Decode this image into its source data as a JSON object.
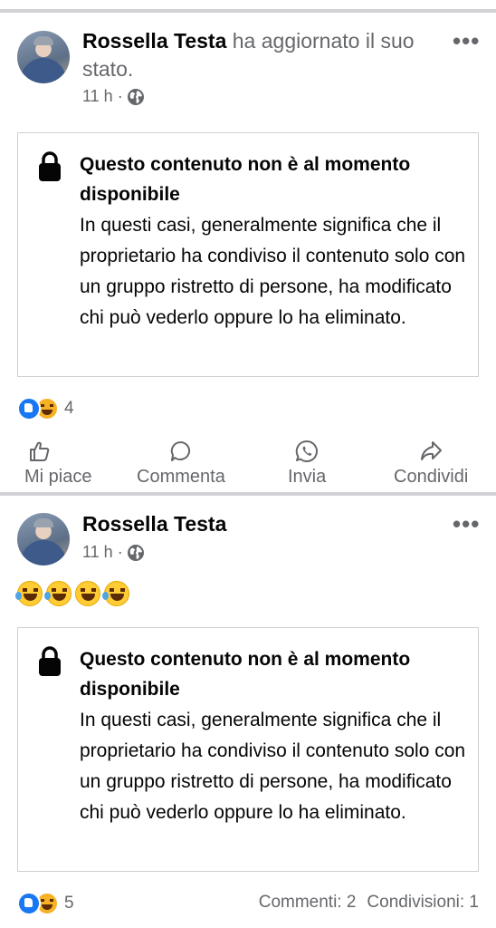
{
  "post1": {
    "author": "Rossella Testa",
    "status": " ha aggiornato il suo stato.",
    "time": "11 h ·",
    "menu": "•••",
    "unavailable_title": "Questo contenuto non è al momento disponibile",
    "unavailable_body": "In questi casi, generalmente significa che il proprietario ha condiviso il contenuto solo con un gruppo ristretto di persone, ha modificato chi può vederlo oppure lo ha eliminato.",
    "reaction_count": "4",
    "reaction_icons": [
      "like-icon",
      "haha-icon"
    ],
    "actions": [
      {
        "label": "Mi piace",
        "icon": "thumbs-up-icon"
      },
      {
        "label": "Commenta",
        "icon": "comment-icon"
      },
      {
        "label": "Invia",
        "icon": "whatsapp-icon"
      },
      {
        "label": "Condividi",
        "icon": "share-icon"
      }
    ]
  },
  "post2": {
    "author": "Rossella Testa",
    "time": "11 h ·",
    "menu": "•••",
    "emojis": [
      "rolling-laughing",
      "rolling-laughing",
      "grinning-sweat",
      "rolling-laughing"
    ],
    "unavailable_title": "Questo contenuto non è al momento disponibile",
    "unavailable_body": "In questi casi, generalmente significa che il proprietario ha condiviso il contenuto solo con un gruppo ristretto di persone, ha modificato chi può vederlo oppure lo ha eliminato.",
    "reaction_count": "5",
    "comments": "Commenti: 2",
    "shares": "Condivisioni: 1"
  },
  "colors": {
    "accent": "#1877f2",
    "secondary_text": "#65676b",
    "separator": "#d0d2d6"
  }
}
